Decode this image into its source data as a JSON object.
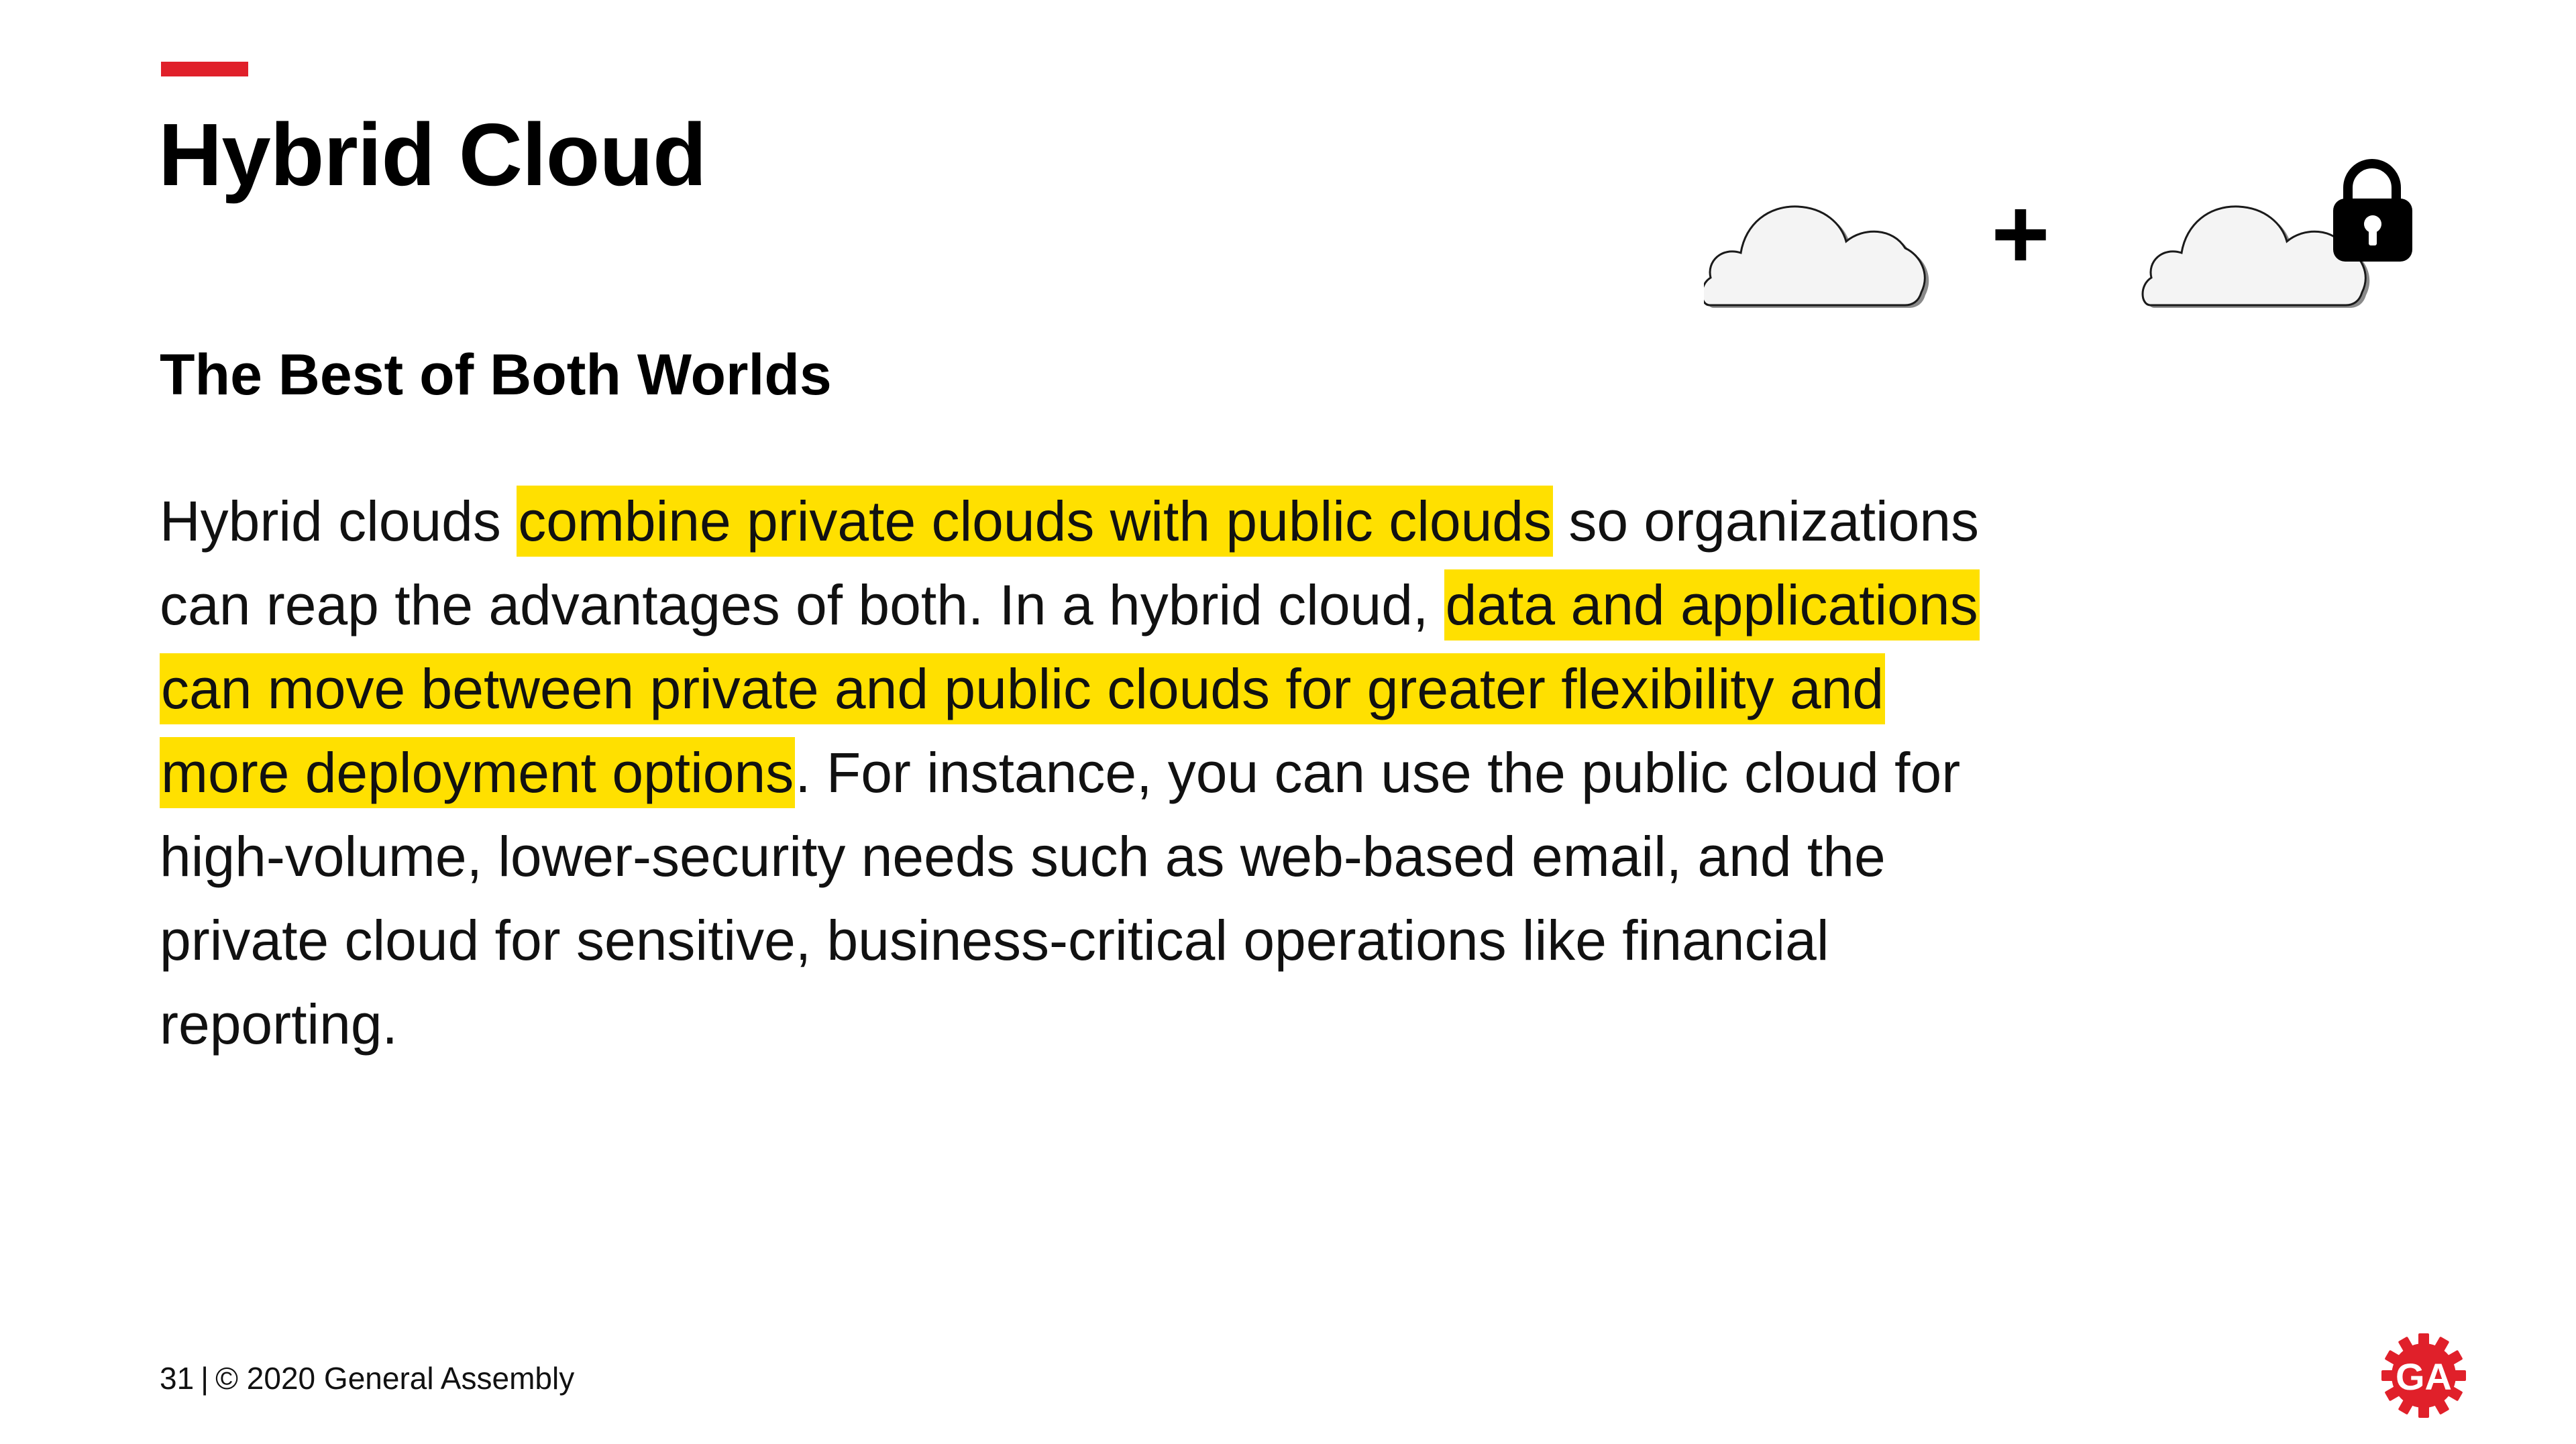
{
  "slide": {
    "title": "Hybrid Cloud",
    "subtitle": "The Best of Both Worlds",
    "body": {
      "part1": "Hybrid clouds ",
      "highlight1": "combine private clouds with public clouds",
      "part2": " so organizations can reap the advantages of both. In a hybrid cloud, ",
      "highlight2": "data and applications can move between private and public clouds for greater flexibility and more deployment options",
      "part3": ". For instance, you can use the public cloud for high-volume, lower-security needs such as web-based email, and the private cloud for sensitive, business-critical operations like financial reporting."
    }
  },
  "illustration": {
    "left_icon": "public-cloud-icon",
    "operator": "+",
    "right_icon": "private-cloud-lock-icon"
  },
  "footer": {
    "page_number": "31",
    "separator": "|",
    "copyright": "© 2020 General Assembly"
  },
  "logo": {
    "text": "GA",
    "icon": "general-assembly-gear-logo"
  },
  "colors": {
    "accent": "#e0202a",
    "highlight": "#ffe000",
    "text": "#111111"
  }
}
